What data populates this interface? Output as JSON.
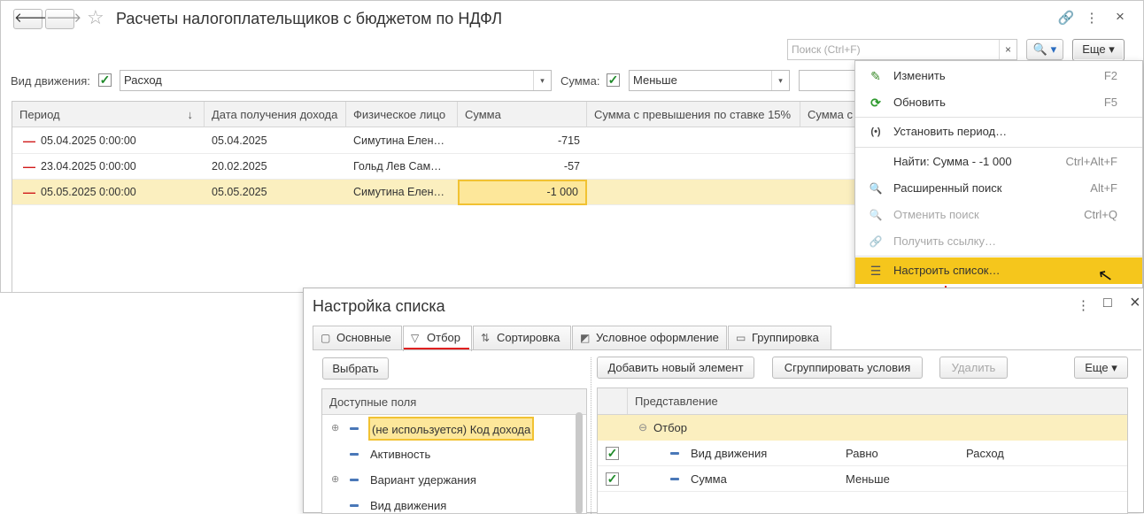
{
  "main": {
    "title": "Расчеты налогоплательщиков с бюджетом по НДФЛ",
    "back_glyph": "🡐",
    "forward_glyph": "🡒",
    "star_glyph": "☆",
    "link_glyph": "🔗",
    "kebab_glyph": "⋮",
    "close_glyph": "×",
    "search_placeholder": "Поиск (Ctrl+F)",
    "search_clear": "×",
    "search_button": "🔍 ▾",
    "more_button": "Еще ▾",
    "filters": {
      "movement_label": "Вид движения:",
      "movement_value": "Расход",
      "sum_label": "Сумма:",
      "sum_value": "Меньше",
      "check": "✓",
      "arrow": "▾"
    },
    "grid": {
      "columns": [
        "Период",
        "Дата получения дохода",
        "Физическое лицо",
        "Сумма",
        "Сумма с превышения по ставке 15%",
        "Сумма с"
      ],
      "sort_glyph": "↓",
      "rows": [
        {
          "marker": "—",
          "period": "05.04.2025 0:00:00",
          "income_date": "05.04.2025",
          "person": "Симутина Елен…",
          "sum": "-715"
        },
        {
          "marker": "—",
          "period": "23.04.2025 0:00:00",
          "income_date": "20.02.2025",
          "person": "Гольд Лев Сам…",
          "sum": "-57"
        },
        {
          "marker": "—",
          "period": "05.05.2025 0:00:00",
          "income_date": "05.05.2025",
          "person": "Симутина Елен…",
          "sum": "-1 000"
        }
      ]
    }
  },
  "menu": {
    "items": [
      {
        "icon": "✎",
        "label": "Изменить",
        "shortcut": "F2"
      },
      {
        "icon": "⟳",
        "label": "Обновить",
        "shortcut": "F5"
      },
      {
        "icon": "(•)",
        "label": "Установить период…",
        "shortcut": ""
      },
      {
        "icon": "",
        "label": "Найти: Сумма - -1 000",
        "shortcut": "Ctrl+Alt+F"
      },
      {
        "icon": "🔍",
        "label": "Расширенный поиск",
        "shortcut": "Alt+F"
      },
      {
        "icon": "🔍",
        "label": "Отменить поиск",
        "shortcut": "Ctrl+Q"
      },
      {
        "icon": "🔗",
        "label": "Получить ссылку…",
        "shortcut": ""
      },
      {
        "icon": "☰",
        "label": "Настроить список…",
        "shortcut": ""
      }
    ],
    "cursor_glyph": "↖"
  },
  "dialog": {
    "title": "Настройка списка",
    "kebab_glyph": "⋮",
    "maximize_glyph": "□",
    "close_glyph": "×",
    "tabs": [
      {
        "icon": "▢",
        "label": "Основные"
      },
      {
        "icon": "▽",
        "label": "Отбор"
      },
      {
        "icon": "⇅",
        "label": "Сортировка"
      },
      {
        "icon": "◩",
        "label": "Условное оформление"
      },
      {
        "icon": "▭",
        "label": "Группировка"
      }
    ],
    "select_button": "Выбрать",
    "add_button": "Добавить новый элемент",
    "group_button": "Сгруппировать условия",
    "delete_button": "Удалить",
    "more_button": "Еще ▾",
    "fields_header": "Доступные поля",
    "fields": [
      {
        "expand": "⊕",
        "label": "(не используется) Код дохода"
      },
      {
        "expand": "",
        "label": "Активность"
      },
      {
        "expand": "⊕",
        "label": "Вариант удержания"
      },
      {
        "expand": "",
        "label": "Вид движения"
      }
    ],
    "filter_header": "Представление",
    "filter_group": {
      "expand": "⊖",
      "label": "Отбор"
    },
    "filter_rows": [
      {
        "check": "✓",
        "field": "Вид движения",
        "op": "Равно",
        "value": "Расход"
      },
      {
        "check": "✓",
        "field": "Сумма",
        "op": "Меньше",
        "value": ""
      }
    ]
  }
}
